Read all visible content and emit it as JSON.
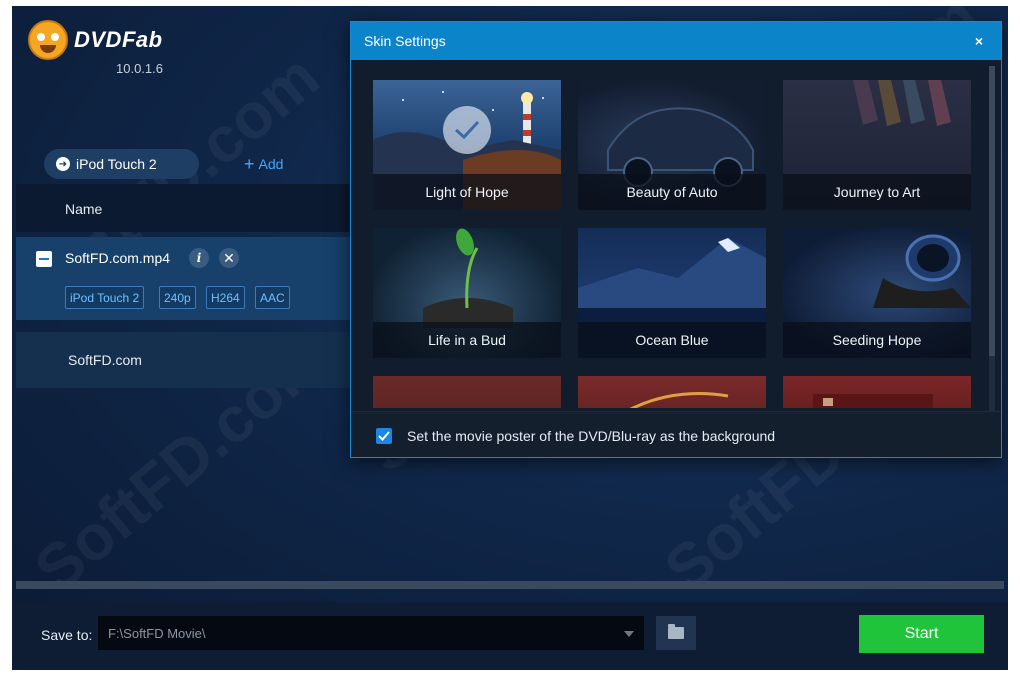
{
  "app": {
    "name": "DVDFab",
    "version": "10.0.1.6"
  },
  "profile": {
    "label": "iPod Touch 2"
  },
  "add": {
    "label": "Add"
  },
  "list": {
    "header": "Name",
    "file": {
      "name": "SoftFD.com.mp4",
      "tags": [
        "iPod Touch 2",
        "240p",
        "H264",
        "AAC"
      ]
    },
    "title": "SoftFD.com"
  },
  "dialog": {
    "title": "Skin Settings",
    "close": "×",
    "skins": [
      {
        "label": "Light of Hope",
        "selected": true
      },
      {
        "label": "Beauty of Auto"
      },
      {
        "label": "Journey to Art"
      },
      {
        "label": "Life in a Bud"
      },
      {
        "label": "Ocean Blue"
      },
      {
        "label": "Seeding Hope"
      },
      {
        "label": ""
      },
      {
        "label": ""
      },
      {
        "label": ""
      }
    ],
    "poster_option": {
      "label": "Set the movie poster of the DVD/Blu-ray as the background",
      "checked": true
    }
  },
  "bottom": {
    "save_label": "Save to:",
    "save_path": "F:\\SoftFD Movie\\",
    "start_label": "Start"
  },
  "colors": {
    "accent": "#0b84c9",
    "start": "#1fc43a",
    "link": "#3ea7ff"
  },
  "watermark": "SoftFD.com"
}
